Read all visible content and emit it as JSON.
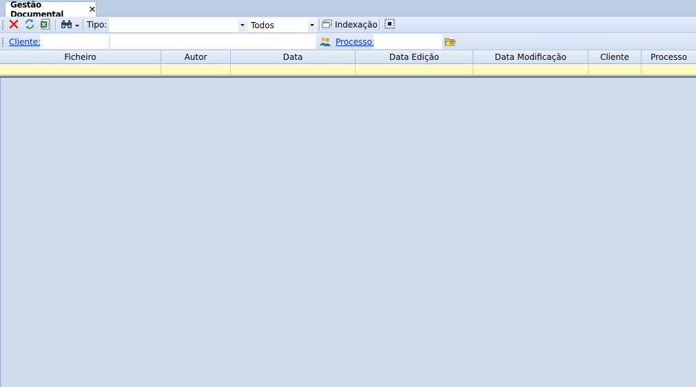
{
  "tab": {
    "title": "Gestão Documental",
    "close_glyph": "✕"
  },
  "toolbar": {
    "delete_icon": "close-red-x-icon",
    "refresh_icon": "refresh-icon",
    "excel_icon": "excel-export-icon",
    "search_icon": "binoculars-icon",
    "tipo_label": "Tipo:",
    "tipo_value": "",
    "filter_value": "Todos",
    "indexacao_label": "Indexação",
    "select_icon": "select-region-icon"
  },
  "filters": {
    "cliente_label": "Cliente:",
    "cliente_code": "",
    "cliente_name": "",
    "processo_label": "Processo:",
    "processo_value": "",
    "users_icon": "users-icon",
    "folder_icon": "folder-open-icon"
  },
  "grid": {
    "columns": [
      "Ficheiro",
      "Autor",
      "Data",
      "Data Edição",
      "Data Modificação",
      "Cliente",
      "Processo"
    ],
    "rows": []
  },
  "colors": {
    "tab_strip": "#bccde4",
    "toolbar": "#d8e4f5",
    "filter_row": "#fdfbc4",
    "link": "#0033cc",
    "body_background": "#d0dcec"
  }
}
